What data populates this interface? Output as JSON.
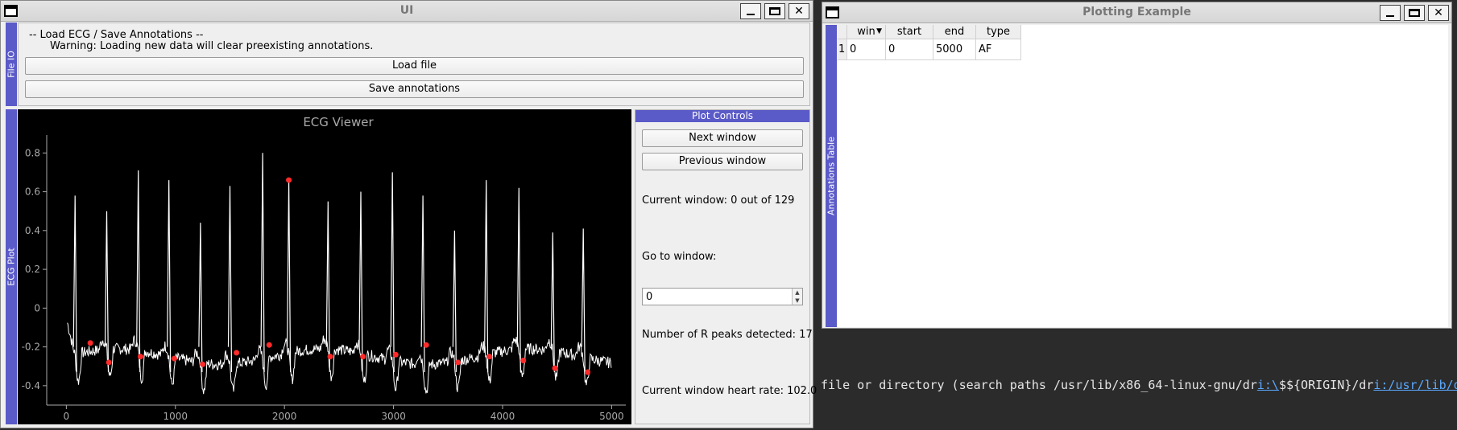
{
  "ui_window": {
    "title": "UI",
    "file_io": {
      "tab_label": "File IO",
      "heading": "-- Load ECG / Save Annotations --",
      "warning": "Warning: Loading new data will clear preexisting annotations.",
      "load_button": "Load file",
      "save_button": "Save annotations"
    },
    "ecg_plot": {
      "tab_label": "ECG Plot"
    },
    "plot_controls": {
      "header": "Plot Controls",
      "next_button": "Next window",
      "prev_button": "Previous window",
      "current_window": "Current window: 0 out of 129",
      "goto_label": "Go to window:",
      "goto_value": "0",
      "r_peaks": "Number of R peaks detected: 17",
      "heart_rate": "Current window heart rate: 102.0"
    }
  },
  "plot_window": {
    "title": "Plotting Example",
    "table_tab_label": "Annotations Table",
    "columns": [
      "win",
      "start",
      "end",
      "type"
    ],
    "rows": [
      {
        "index": "1",
        "win": "0",
        "start": "0",
        "end": "5000",
        "type": "AF"
      }
    ]
  },
  "terminal": {
    "text_before": "file or directory (search paths /usr/lib/x86_64-linux-gnu/dr",
    "link1": "i:\\",
    "text_mid": "$${ORIGIN}/dr",
    "link2": "i:/usr/lib/dri"
  },
  "chart_data": {
    "type": "line",
    "title": "ECG Viewer",
    "xlim": [
      -180,
      5130
    ],
    "ylim": [
      -0.5,
      0.88
    ],
    "xticks": [
      0,
      1000,
      2000,
      3000,
      4000,
      5000
    ],
    "yticks": [
      -0.4,
      -0.2,
      0,
      0.2,
      0.4,
      0.6,
      0.8
    ],
    "colors": {
      "background": "#000000",
      "signal": "#ffffff",
      "peaks": "#ff2a2a",
      "axis": "#aaaaaa"
    },
    "r_peak_spikes": [
      {
        "x": 80,
        "top": 0.58
      },
      {
        "x": 370,
        "top": 0.5
      },
      {
        "x": 660,
        "top": 0.71
      },
      {
        "x": 940,
        "top": 0.66
      },
      {
        "x": 1230,
        "top": 0.44
      },
      {
        "x": 1500,
        "top": 0.63
      },
      {
        "x": 1800,
        "top": 0.8
      },
      {
        "x": 2040,
        "top": 0.66
      },
      {
        "x": 2400,
        "top": 0.55
      },
      {
        "x": 2700,
        "top": 0.6
      },
      {
        "x": 2990,
        "top": 0.7
      },
      {
        "x": 3270,
        "top": 0.58
      },
      {
        "x": 3560,
        "top": 0.4
      },
      {
        "x": 3850,
        "top": 0.66
      },
      {
        "x": 4150,
        "top": 0.62
      },
      {
        "x": 4460,
        "top": 0.39
      },
      {
        "x": 4740,
        "top": 0.41
      }
    ],
    "annotated_peaks": [
      {
        "x": 220,
        "y": -0.18
      },
      {
        "x": 390,
        "y": -0.28
      },
      {
        "x": 680,
        "y": -0.25
      },
      {
        "x": 990,
        "y": -0.26
      },
      {
        "x": 1250,
        "y": -0.29
      },
      {
        "x": 1560,
        "y": -0.23
      },
      {
        "x": 1860,
        "y": -0.19
      },
      {
        "x": 2040,
        "y": 0.66
      },
      {
        "x": 2420,
        "y": -0.25
      },
      {
        "x": 2720,
        "y": -0.25
      },
      {
        "x": 3020,
        "y": -0.24
      },
      {
        "x": 3300,
        "y": -0.19
      },
      {
        "x": 3590,
        "y": -0.28
      },
      {
        "x": 3880,
        "y": -0.25
      },
      {
        "x": 4190,
        "y": -0.27
      },
      {
        "x": 4480,
        "y": -0.31
      },
      {
        "x": 4780,
        "y": -0.33
      }
    ]
  }
}
